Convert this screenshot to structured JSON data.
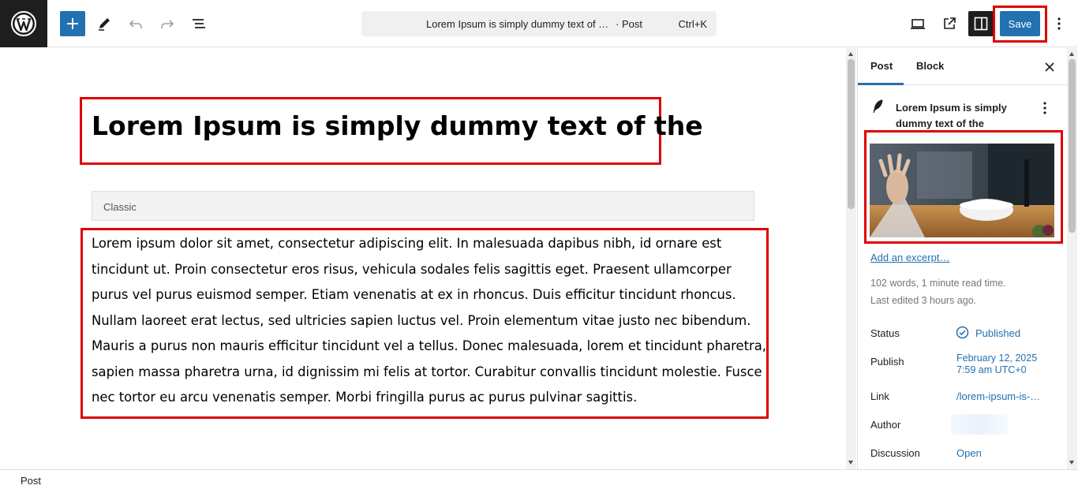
{
  "toolbar": {
    "document_title": "Lorem Ipsum is simply dummy text of …",
    "document_type": "· Post",
    "shortcut": "Ctrl+K",
    "save_label": "Save",
    "accent_color": "#2271b1"
  },
  "editor": {
    "post_title": "Lorem Ipsum is simply dummy text of the",
    "classic_block_label": "Classic",
    "paragraph_lines": [
      "Lorem ipsum dolor sit amet, consectetur adipiscing elit. In malesuada dapibus nibh, id ornare est",
      "tincidunt ut. Proin consectetur eros risus, vehicula sodales felis sagittis eget. Praesent ullamcorper",
      "purus vel purus euismod semper. Etiam venenatis at ex in rhoncus. Duis efficitur tincidunt rhoncus.",
      "Nullam laoreet erat lectus, sed ultricies sapien luctus vel. Proin elementum vitae justo nec bibendum.",
      "Mauris a purus non mauris efficitur tincidunt vel a tellus. Donec malesuada, lorem et tincidunt pharetra,",
      "sapien massa pharetra urna, id dignissim mi felis at tortor. Curabitur convallis tincidunt molestie. Fusce",
      "nec tortor eu arcu venenatis semper. Morbi fringilla purus ac purus pulvinar sagittis."
    ]
  },
  "sidebar": {
    "tabs": [
      {
        "label": "Post",
        "active": true
      },
      {
        "label": "Block",
        "active": false
      }
    ],
    "post_summary_title": "Lorem Ipsum is simply dummy text of the",
    "excerpt_link": "Add an excerpt…",
    "word_count": "102 words, 1 minute read time.",
    "last_edited": "Last edited 3 hours ago.",
    "rows": {
      "status": {
        "label": "Status",
        "value": "Published"
      },
      "publish": {
        "label": "Publish",
        "value_line1": "February 12, 2025",
        "value_line2": "7:59 am UTC+0"
      },
      "link": {
        "label": "Link",
        "value": "/lorem-ipsum-is-…"
      },
      "author": {
        "label": "Author"
      },
      "discussion": {
        "label": "Discussion",
        "value": "Open"
      }
    }
  },
  "footer": {
    "breadcrumb": "Post"
  },
  "icons": [
    "wordpress-logo-icon",
    "plus-icon",
    "pencil-icon",
    "undo-icon",
    "redo-icon",
    "list-view-icon",
    "desktop-preview-icon",
    "external-link-icon",
    "sidebar-toggle-icon",
    "more-vertical-icon",
    "close-icon",
    "feather-icon",
    "published-check-icon"
  ],
  "highlight_color": "#e00000"
}
